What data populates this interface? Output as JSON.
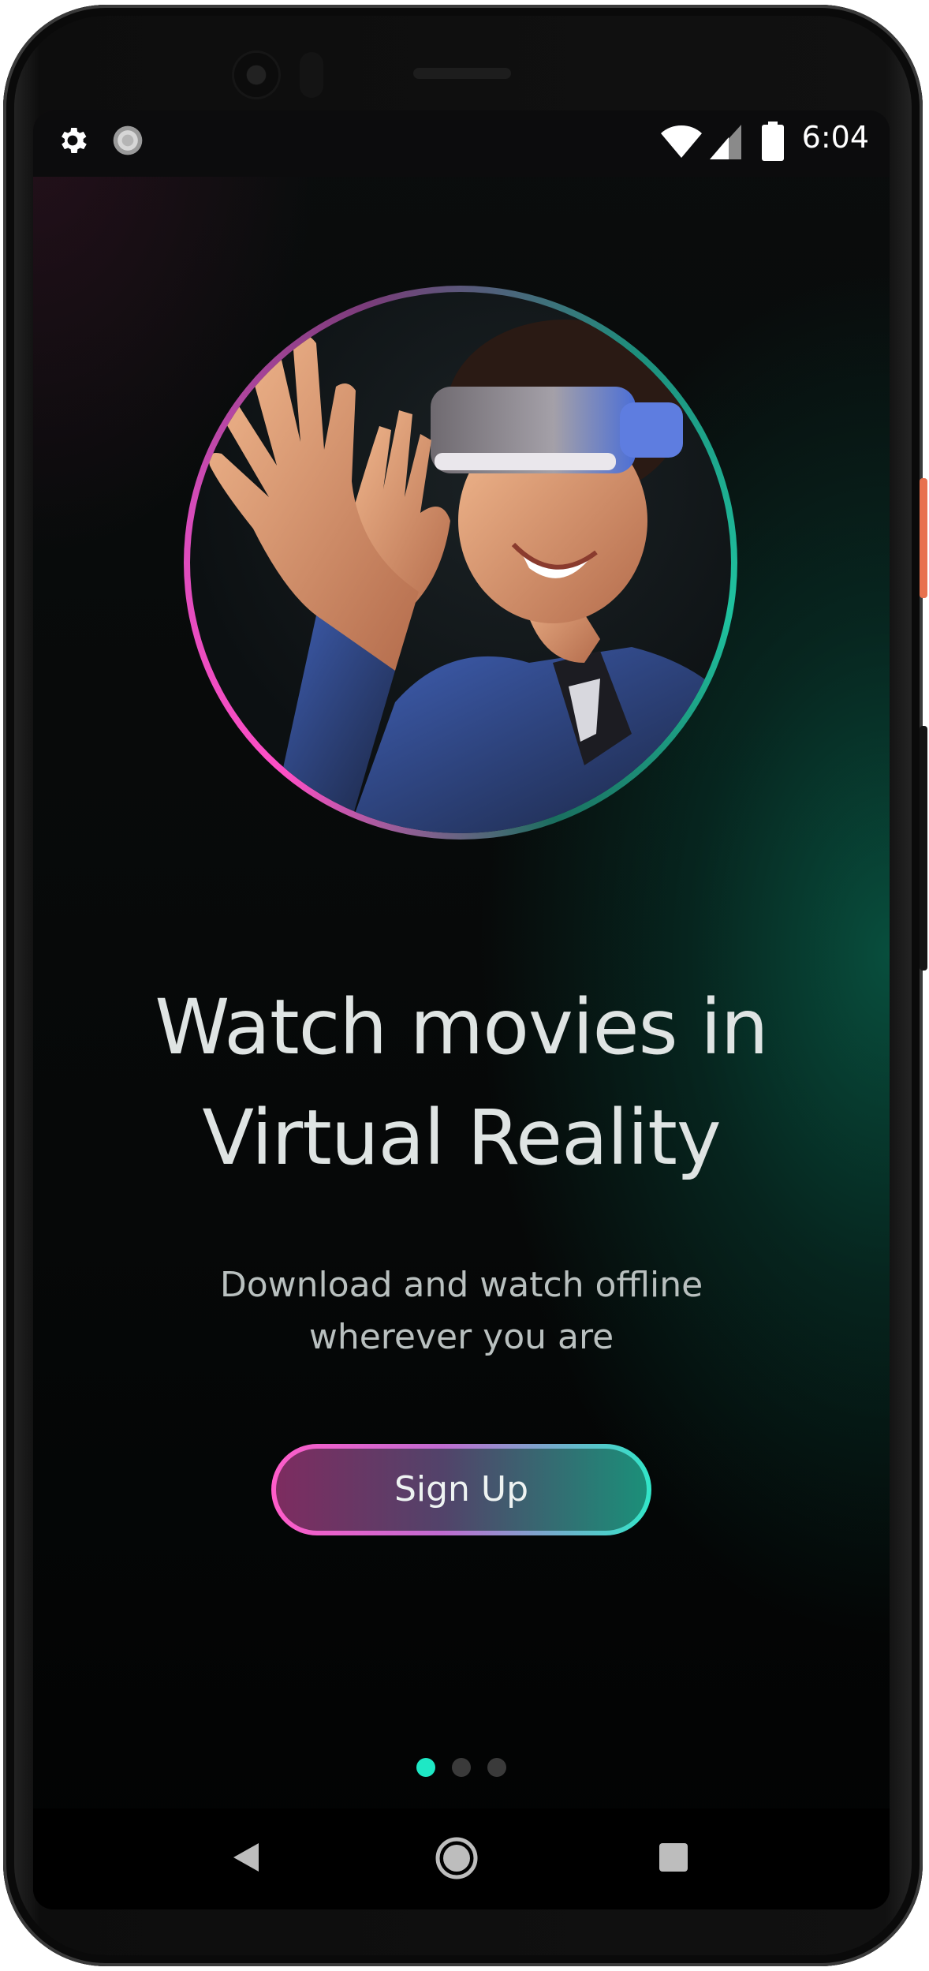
{
  "status_bar": {
    "time": "6:04",
    "left_icons": [
      "gear-icon",
      "sync-icon"
    ],
    "right_icons": [
      "wifi-icon",
      "cell-signal-icon",
      "battery-icon"
    ]
  },
  "hero": {
    "image_alt": "person wearing VR headset",
    "ring_colors": [
      "#ff4fc6",
      "#1fc3a0"
    ]
  },
  "onboarding": {
    "headline_line1": "Watch movies in",
    "headline_line2": "Virtual Reality",
    "subtitle_line1": "Download and watch offline",
    "subtitle_line2": "wherever you are",
    "cta_label": "Sign Up",
    "page_total": 3,
    "page_active": 1
  },
  "nav_bar": {
    "buttons": [
      "back-icon",
      "home-icon",
      "recents-icon"
    ]
  },
  "colors": {
    "accent_pink": "#ff5cc9",
    "accent_teal": "#31e6c8",
    "dot_active": "#1ee8c5",
    "dot_inactive": "#3a3a3a",
    "background": "#060808"
  }
}
